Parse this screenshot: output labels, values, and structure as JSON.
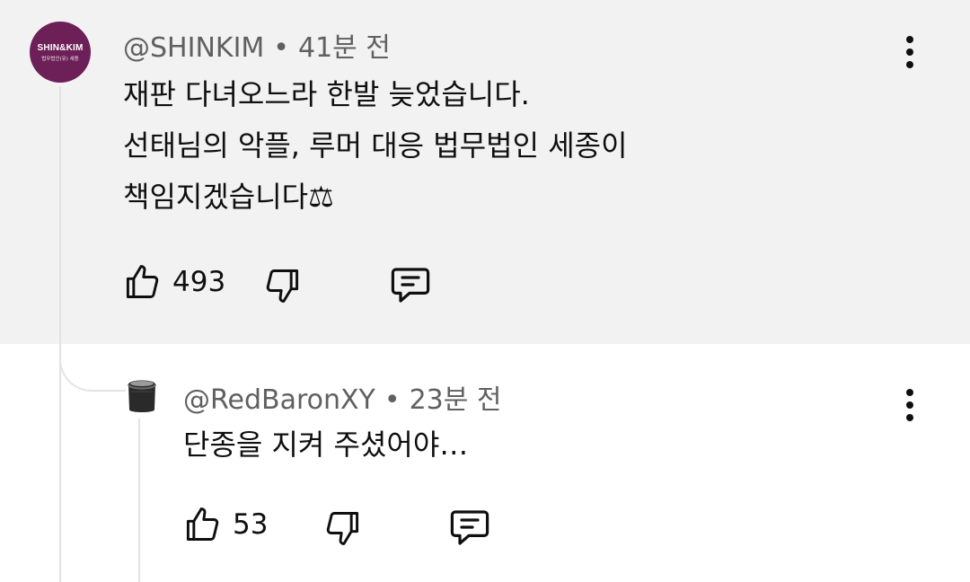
{
  "comments": [
    {
      "author": "@SHINKIM",
      "separator": "•",
      "time": "41분 전",
      "avatar": {
        "brand": "SHIN&KIM",
        "sub": "법무법인(유) 세종",
        "color": "#6d1f58"
      },
      "lines": [
        "재판 다녀오느라 한발 늦었습니다.",
        "선태님의 악플, 루머 대응 법무법인 세종이",
        "책임지겠습니다⚖"
      ],
      "likes": "493",
      "icons": [
        "thumbs-up-icon",
        "thumbs-down-icon",
        "reply-icon",
        "more-vertical-icon"
      ]
    },
    {
      "author": "@RedBaronXY",
      "separator": "•",
      "time": "23분 전",
      "lines": [
        "단종을 지켜 주셨어야…"
      ],
      "likes": "53",
      "icons": [
        "thumbs-up-icon",
        "thumbs-down-icon",
        "reply-icon",
        "more-vertical-icon"
      ]
    }
  ],
  "colors": {
    "highlight_bg": "#f2f2f2",
    "meta_text": "#606060",
    "body_text": "#0f0f0f"
  }
}
